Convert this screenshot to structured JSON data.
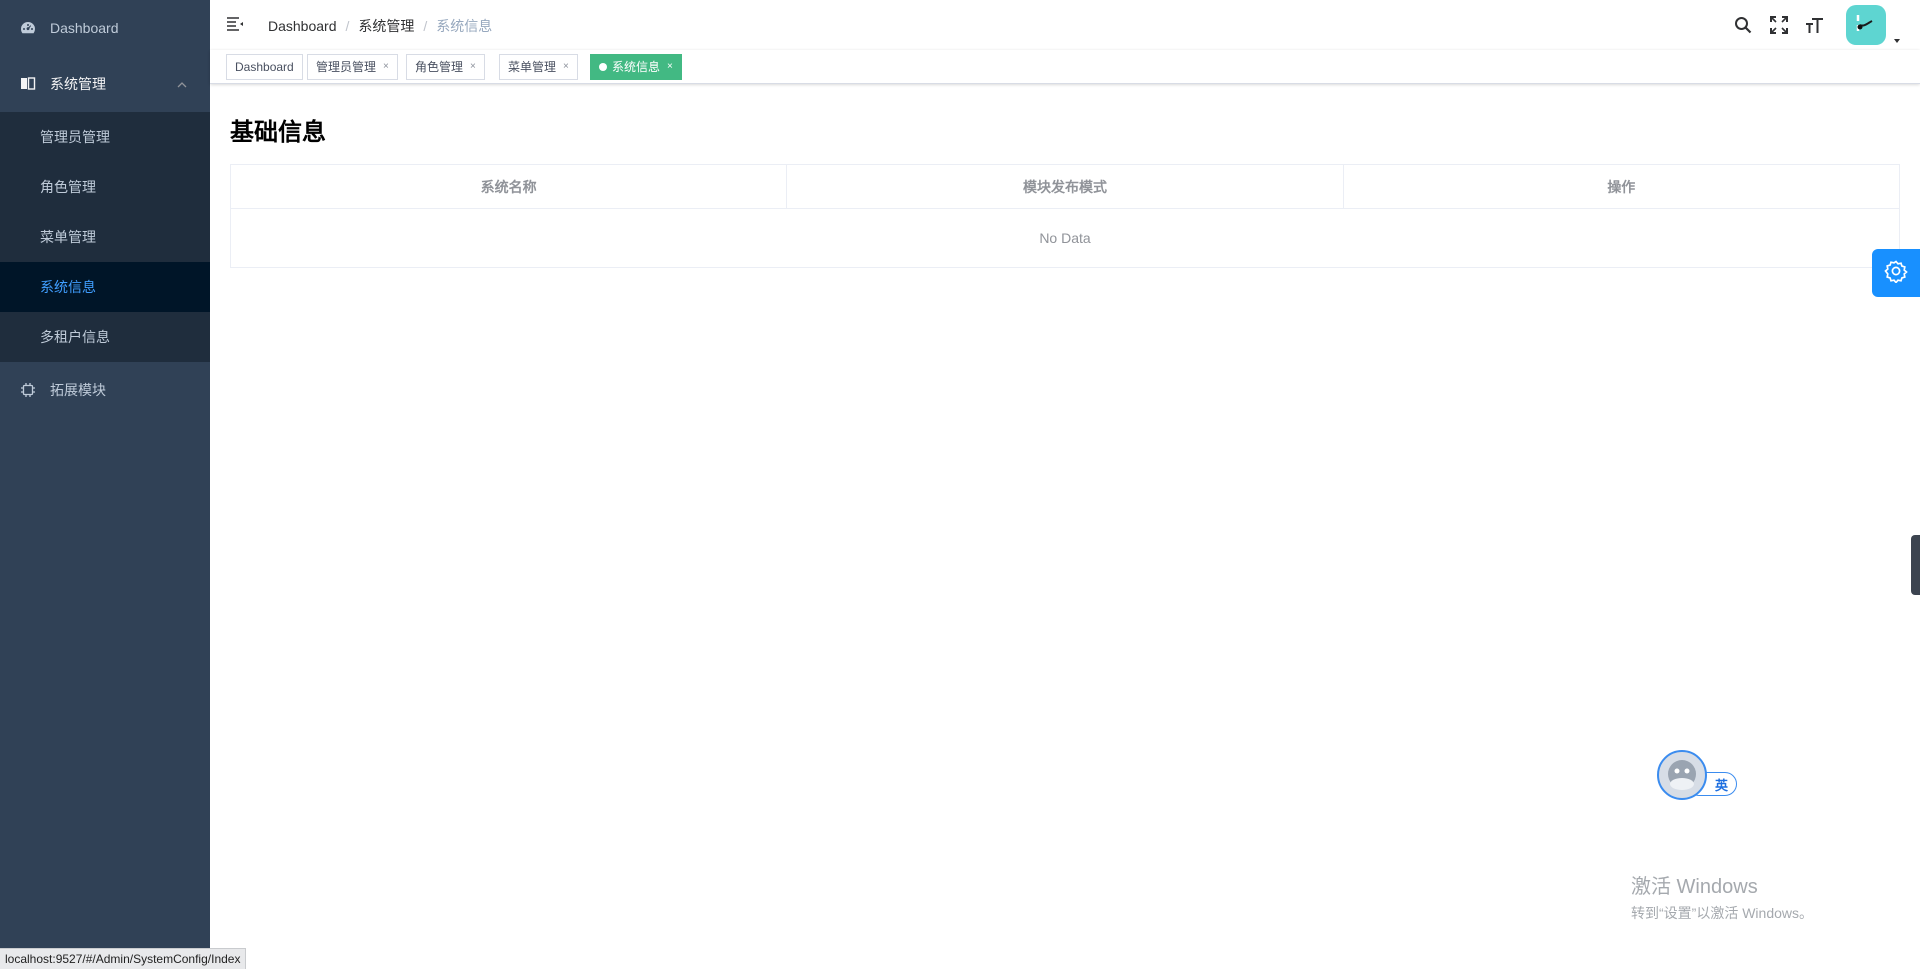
{
  "sidebar": {
    "dashboard_label": "Dashboard",
    "system_group_label": "系统管理",
    "sub_items": [
      {
        "label": "管理员管理"
      },
      {
        "label": "角色管理"
      },
      {
        "label": "菜单管理"
      },
      {
        "label": "系统信息"
      },
      {
        "label": "多租户信息"
      }
    ],
    "active_sub_item": "系统信息",
    "extension_label": "拓展模块"
  },
  "navbar": {
    "breadcrumb": [
      "Dashboard",
      "系统管理",
      "系统信息"
    ],
    "breadcrumb_separator": "/",
    "icons": [
      "hamburger-icon",
      "search-icon",
      "fullscreen-icon",
      "font-size-icon",
      "avatar",
      "caret-down-icon"
    ]
  },
  "tags": [
    {
      "label": "Dashboard",
      "closable": false
    },
    {
      "label": "管理员管理",
      "closable": true
    },
    {
      "label": "角色管理",
      "closable": true
    },
    {
      "label": "菜单管理",
      "closable": true
    },
    {
      "label": "系统信息",
      "closable": true,
      "active": true
    }
  ],
  "tag_close_glyph": "×",
  "main": {
    "title": "基础信息",
    "table": {
      "columns": [
        "系统名称",
        "模块发布模式",
        "操作"
      ],
      "rows": [],
      "empty_text": "No Data"
    }
  },
  "ime": {
    "label": "英"
  },
  "watermark": {
    "line1": "激活 Windows",
    "line2": "转到“设置”以激活 Windows。"
  },
  "status_url": "localhost:9527/#/Admin/SystemConfig/Index",
  "colors": {
    "sidebar_bg": "#304156",
    "submenu_bg": "#1f2d3d",
    "active_submenu_bg": "#001528",
    "active_text": "#409eff",
    "tag_active": "#42b983",
    "settings_button": "#1890ff"
  }
}
